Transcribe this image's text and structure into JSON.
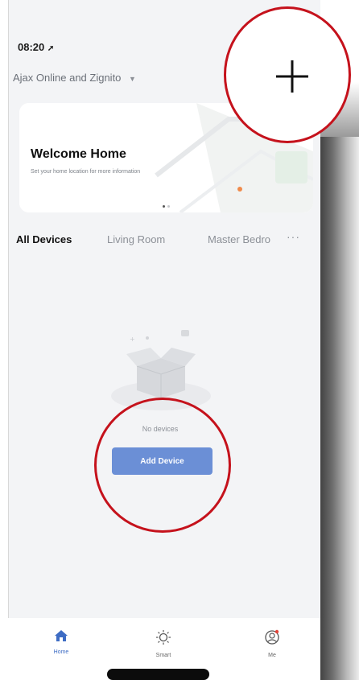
{
  "status_bar": {
    "time": "08:20",
    "location_icon": "location-arrow-icon"
  },
  "header": {
    "home_name": "Ajax Online and Zignito",
    "caret_icon": "chevron-down-icon",
    "add_icon": "plus-icon"
  },
  "welcome": {
    "title": "Welcome Home",
    "subtitle": "Set your home location for more information",
    "page_dots": 2,
    "active_dot": 1
  },
  "tabs": [
    {
      "label": "All Devices",
      "active": true
    },
    {
      "label": "Living Room",
      "active": false
    },
    {
      "label": "Master Bedro",
      "active": false
    }
  ],
  "tabs_more_icon": "ellipsis-icon",
  "empty_state": {
    "message": "No devices",
    "button_label": "Add Device"
  },
  "bottom_nav": [
    {
      "label": "Home",
      "icon": "home-icon",
      "active": true
    },
    {
      "label": "Smart",
      "icon": "sun-icon",
      "active": false
    },
    {
      "label": "Me",
      "icon": "profile-icon",
      "active": false
    }
  ],
  "colors": {
    "accent": "#3e6cc4",
    "button": "#6b8fd6",
    "annotation": "#c5121c",
    "background": "#f3f4f6"
  }
}
